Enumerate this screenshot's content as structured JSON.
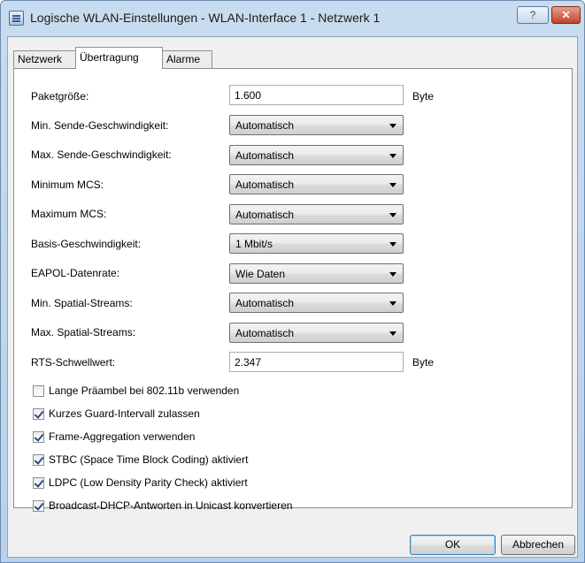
{
  "window": {
    "title": "Logische WLAN-Einstellungen - WLAN-Interface 1 - Netzwerk 1",
    "help_label": "?",
    "close_label": "✕"
  },
  "tabs": [
    {
      "label": "Netzwerk",
      "active": false
    },
    {
      "label": "Übertragung",
      "active": true
    },
    {
      "label": "Alarme",
      "active": false
    }
  ],
  "fields": {
    "packet_size": {
      "label": "Paketgröße:",
      "value": "1.600",
      "unit": "Byte"
    },
    "min_send_rate": {
      "label": "Min. Sende-Geschwindigkeit:",
      "value": "Automatisch"
    },
    "max_send_rate": {
      "label": "Max. Sende-Geschwindigkeit:",
      "value": "Automatisch"
    },
    "min_mcs": {
      "label": "Minimum MCS:",
      "value": "Automatisch"
    },
    "max_mcs": {
      "label": "Maximum MCS:",
      "value": "Automatisch"
    },
    "base_rate": {
      "label": "Basis-Geschwindigkeit:",
      "value": "1 Mbit/s"
    },
    "eapol_rate": {
      "label": "EAPOL-Datenrate:",
      "value": "Wie Daten"
    },
    "min_spatial": {
      "label": "Min. Spatial-Streams:",
      "value": "Automatisch"
    },
    "max_spatial": {
      "label": "Max. Spatial-Streams:",
      "value": "Automatisch"
    },
    "rts_threshold": {
      "label": "RTS-Schwellwert:",
      "value": "2.347",
      "unit": "Byte"
    }
  },
  "checkboxes": [
    {
      "label": "Lange Präambel bei 802.11b verwenden",
      "checked": false
    },
    {
      "label": "Kurzes Guard-Intervall zulassen",
      "checked": true
    },
    {
      "label": "Frame-Aggregation verwenden",
      "checked": true
    },
    {
      "label": "STBC (Space Time Block Coding) aktiviert",
      "checked": true
    },
    {
      "label": "LDPC (Low Density Parity Check) aktiviert",
      "checked": true
    },
    {
      "label": "Broadcast-DHCP-Antworten in Unicast konvertieren",
      "checked": true
    }
  ],
  "buttons": {
    "ok": "OK",
    "cancel": "Abbrechen"
  }
}
